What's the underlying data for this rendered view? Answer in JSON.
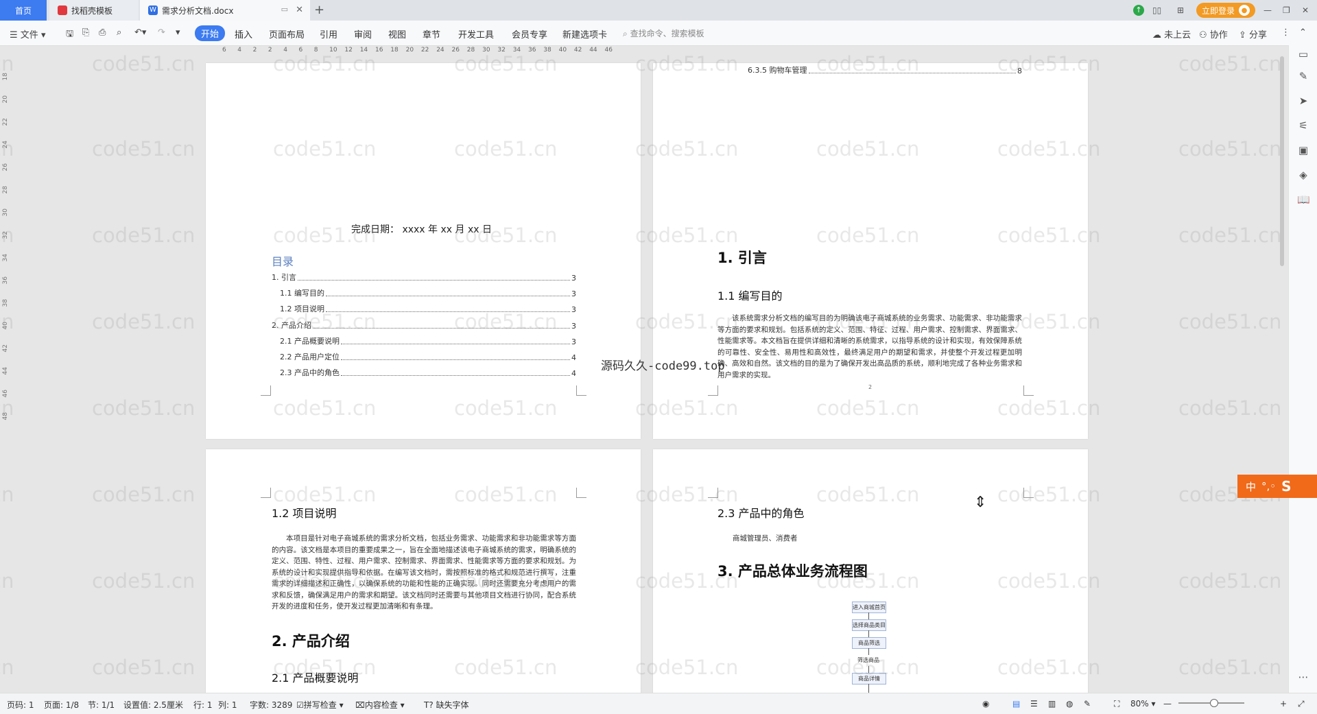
{
  "titlebar": {
    "tabs": [
      {
        "label": "首页"
      },
      {
        "label": "找稻壳模板"
      },
      {
        "label": "需求分析文档.docx"
      }
    ],
    "login_label": "立即登录"
  },
  "menubar": {
    "file_label": "文件",
    "items": [
      "开始",
      "插入",
      "页面布局",
      "引用",
      "审阅",
      "视图",
      "章节",
      "开发工具",
      "会员专享",
      "新建选项卡"
    ],
    "search_placeholder": "查找命令、搜索模板",
    "right": {
      "cloud": "未上云",
      "collab": "协作",
      "share": "分享"
    }
  },
  "ruler": {
    "h_ticks": [
      "6",
      "4",
      "2",
      "2",
      "4",
      "6",
      "8",
      "10",
      "12",
      "14",
      "16",
      "18",
      "20",
      "22",
      "24",
      "26",
      "28",
      "30",
      "32",
      "34",
      "36",
      "38",
      "40",
      "42",
      "44",
      "46"
    ],
    "v_ticks": [
      "18",
      "20",
      "22",
      "24",
      "26",
      "28",
      "30",
      "32",
      "34",
      "36",
      "38",
      "40",
      "42",
      "44",
      "46",
      "48"
    ]
  },
  "page1": {
    "date_line": "完成日期： xxxx 年  xx 月 xx 日",
    "toc_title": "目录",
    "toc": [
      {
        "label": "1.  引言",
        "page": "3",
        "level": 1
      },
      {
        "label": "1.1  编写目的",
        "page": "3",
        "level": 2
      },
      {
        "label": "1.2  项目说明",
        "page": "3",
        "level": 2
      },
      {
        "label": "2.  产品介绍",
        "page": "3",
        "level": 1
      },
      {
        "label": "2.1  产品概要说明",
        "page": "3",
        "level": 2
      },
      {
        "label": "2.2  产品用户定位",
        "page": "4",
        "level": 2
      },
      {
        "label": "2.3  产品中的角色",
        "page": "4",
        "level": 2
      }
    ]
  },
  "page2": {
    "top_toc": {
      "label": "6.3.5  购物车管理",
      "page": "8"
    },
    "h1": "1.  引言",
    "h2": "1.1  编写目的",
    "paragraph": "该系统需求分析文档的编写目的为明确该电子商城系统的业务需求、功能需求、非功能需求等方面的要求和规划。包括系统的定义、范围、特征、过程、用户需求、控制需求、界面需求、性能需求等。本文档旨在提供详细和清晰的系统需求，以指导系统的设计和实现，有效保障系统的可靠性、安全性、易用性和高效性，最终满足用户的期望和需求，并使整个开发过程更加明确、高效和自然。该文档的目的是为了确保开发出高品质的系统，顺利地完成了各种业务需求和用户需求的实现。",
    "page_no": "2"
  },
  "page3": {
    "h2a": "1.2  项目说明",
    "paragraph": "本项目是针对电子商城系统的需求分析文档，包括业务需求、功能需求和非功能需求等方面的内容。该文档是本项目的重要成果之一，旨在全面地描述该电子商城系统的需求，明确系统的定义、范围、特性、过程、用户需求、控制需求、界面需求、性能需求等方面的要求和规划。为系统的设计和实现提供指导和依据。在编写该文档时，需按照标准的格式和规范进行撰写，注重需求的详细描述和正确性，以确保系统的功能和性能的正确实现。同时还需要充分考虑用户的需求和反馈，确保满足用户的需求和期望。该文档同时还需要与其他项目文档进行协同，配合系统开发的进度和任务，使开发过程更加清晰和有条理。",
    "h1": "2.  产品介绍",
    "h2b": "2.1  产品概要说明"
  },
  "page4": {
    "h2": "2.3  产品中的角色",
    "roles": "商城管理员、消费者",
    "h1": "3.  产品总体业务流程图",
    "flow": [
      "进入商城首页",
      "选择商品类目",
      "商品筛选",
      "筛选商品",
      "商品详情"
    ]
  },
  "overlay_text": "源码久久-code99.top",
  "watermark_text": "code51.cn",
  "ime": {
    "label": "中"
  },
  "statusbar": {
    "page_code": "页码: 1",
    "page": "页面: 1/8",
    "section": "节: 1/1",
    "setting": "设置值: 2.5厘米",
    "row": "行: 1",
    "col": "列: 1",
    "words": "字数: 3289",
    "spell": "拼写检查",
    "content_check": "内容检查",
    "missing_font": "缺失字体",
    "zoom": "80%"
  },
  "colors": {
    "accent": "#3c7bf0",
    "login": "#f29a23",
    "ime": "#f06a1a",
    "toc_title": "#5b7fbf"
  }
}
